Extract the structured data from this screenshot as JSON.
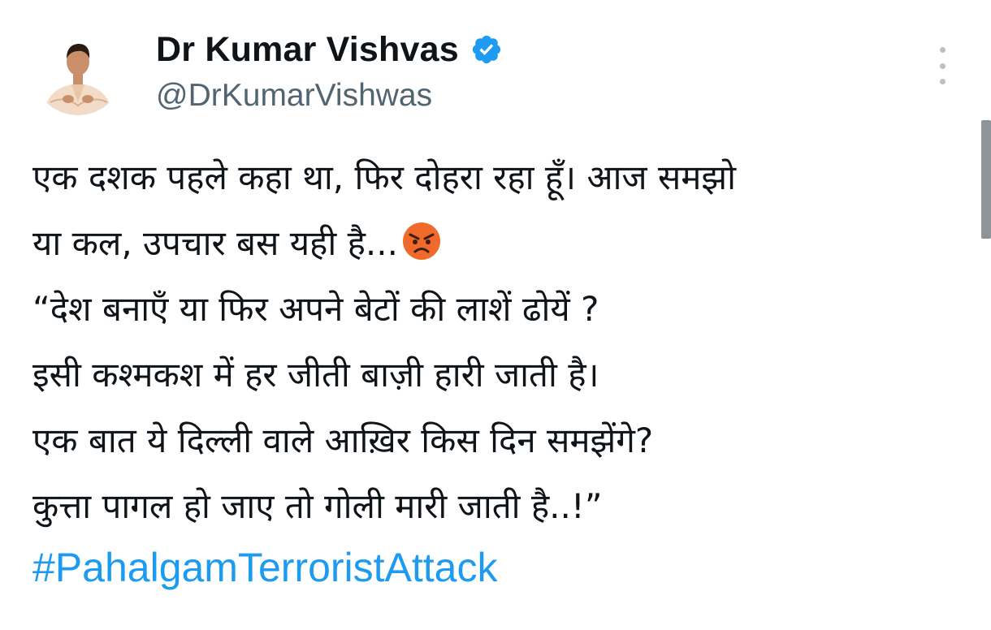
{
  "author": {
    "display_name": "Dr Kumar Vishvas",
    "handle": "@DrKumarVishwas",
    "verified": true,
    "verified_color": "#1d9bf0"
  },
  "tweet": {
    "lines": [
      "एक दशक पहले कहा था, फिर दोहरा रहा हूँ। आज समझो",
      "या कल, उपचार बस यही है...",
      "“देश बनाएँ या फिर अपने बेटों की लाशें ढोयें ?",
      "इसी कश्मकश में हर जीती बाज़ी हारी जाती है।",
      "एक बात ये दिल्ली वाले आख़िर किस दिन समझेंगे?",
      "कुत्ता पागल हो जाए तो गोली मारी जाती है..!”"
    ],
    "emoji": "angry-face",
    "hashtag": "#PahalgamTerroristAttack",
    "hashtag_color": "#1d9bf0"
  },
  "icons": {
    "more": "more-vertical-icon",
    "verified": "verified-badge-icon"
  }
}
